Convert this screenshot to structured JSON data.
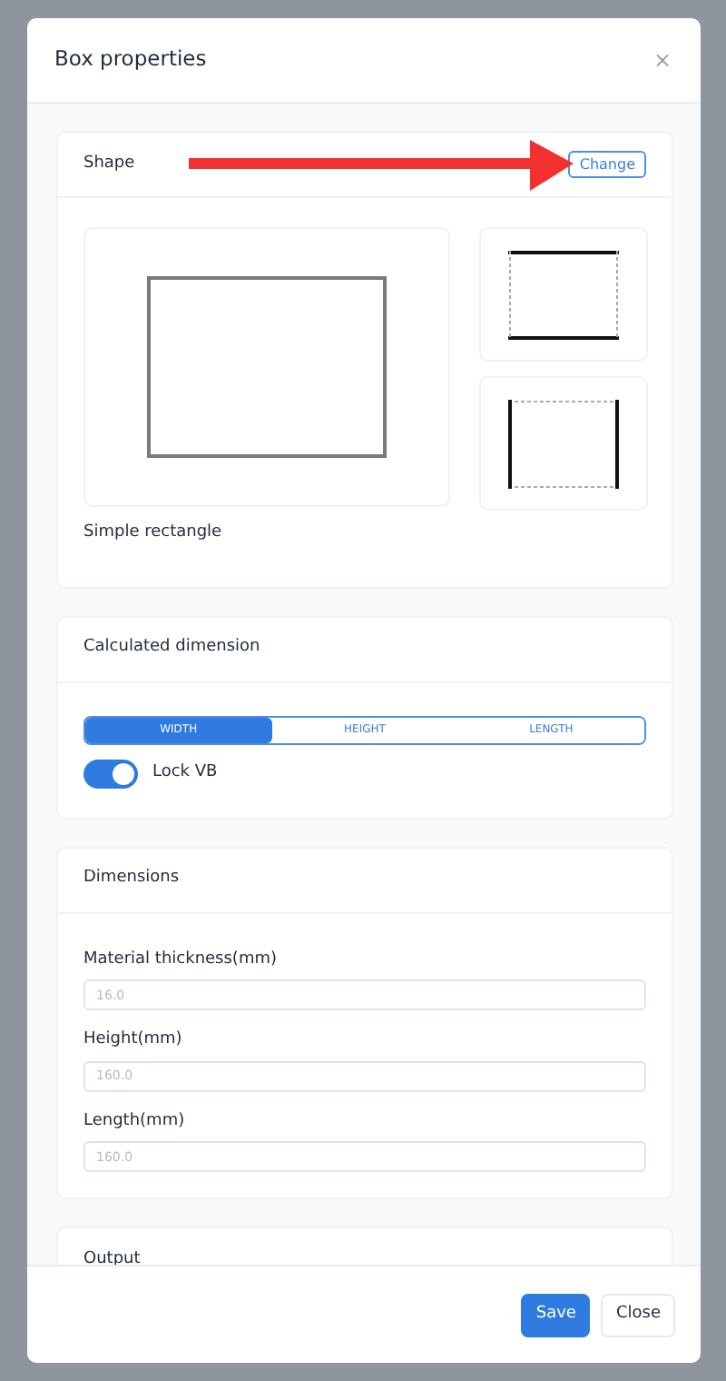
{
  "modal": {
    "title": "Box properties",
    "close": "×"
  },
  "shape": {
    "title": "Shape",
    "button": "Change",
    "name": "Simple rectangle",
    "previews": [
      {
        "kind": "full"
      },
      {
        "kind": "top-bottom"
      },
      {
        "kind": "sides"
      }
    ]
  },
  "calculated": {
    "title": "Calculated dimension",
    "options": [
      {
        "label": "WIDTH",
        "selected": true
      },
      {
        "label": "HEIGHT",
        "selected": false
      },
      {
        "label": "LENGTH",
        "selected": false
      }
    ],
    "lock": {
      "label": "Lock VB",
      "checked": true
    }
  },
  "dimensions": {
    "title": "Dimensions",
    "fields": [
      {
        "label": "Material thickness(mm)",
        "placeholder": "16.0"
      },
      {
        "label": "Height(mm)",
        "placeholder": "160.0"
      },
      {
        "label": "Length(mm)",
        "placeholder": "160.0"
      }
    ]
  },
  "output": {
    "title": "Output"
  },
  "footer": {
    "buttons": [
      {
        "label": "Save",
        "kind": "primary"
      },
      {
        "label": "Close",
        "kind": "secondary"
      }
    ]
  }
}
